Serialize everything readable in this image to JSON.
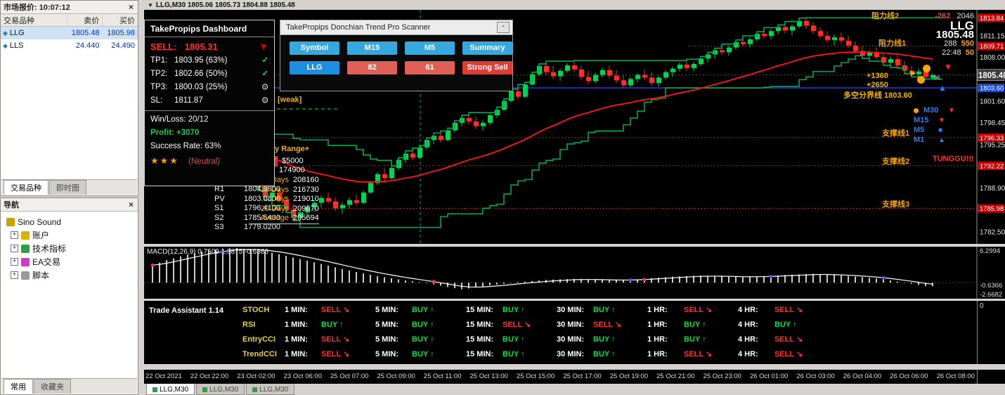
{
  "market_watch": {
    "title": "市场报价: 10:07:12",
    "close": "×",
    "columns": [
      "交易品种",
      "卖价",
      "买价"
    ],
    "rows": [
      {
        "symbol": "LLG",
        "bid": "1805.48",
        "ask": "1805.98"
      },
      {
        "symbol": "LLS",
        "bid": "24.440",
        "ask": "24.490"
      }
    ],
    "tabs": [
      "交易品种",
      "即时图"
    ]
  },
  "navigator": {
    "title": "导航",
    "close": "×",
    "items": [
      {
        "label": "Sino Sound",
        "icon": "speaker-icon",
        "expandable": false
      },
      {
        "label": "账户",
        "icon": "accounts-icon",
        "expandable": true
      },
      {
        "label": "技术指标",
        "icon": "indicators-icon",
        "expandable": true
      },
      {
        "label": "EA交易",
        "icon": "ea-icon",
        "expandable": true
      },
      {
        "label": "脚本",
        "icon": "scripts-icon",
        "expandable": true
      }
    ],
    "tabs": [
      "常用",
      "收藏夹"
    ]
  },
  "chart_titlebar": {
    "dropdown": "▼",
    "title": "LLG,M30 1805.06 1805.73 1804.88 1805.48"
  },
  "dashboard": {
    "title": "TakePropips Dashboard",
    "signal": {
      "label": "SELL:",
      "price": "1805.31",
      "arrow": "▼"
    },
    "targets": [
      {
        "label": "TP1:",
        "value": "1803.95 (63%)",
        "status": "check"
      },
      {
        "label": "TP2:",
        "value": "1802.66 (50%)",
        "status": "check"
      },
      {
        "label": "TP3:",
        "value": "1800.03 (25%)",
        "status": "pending"
      },
      {
        "label": "SL:",
        "value": "1811.87",
        "status": "pending"
      }
    ],
    "stats": [
      {
        "label": "Win/Loss:",
        "value": "20/12",
        "color": "#f2f2f2"
      },
      {
        "label": "Profit:",
        "value": "+3070",
        "color": "#17c94f"
      },
      {
        "label": "Success Rate:",
        "value": "63%",
        "color": "#f2f2f2"
      }
    ],
    "stars": "★★★",
    "rating": "(Neutral)"
  },
  "scanner": {
    "title": "TakePropips Donchian Trend Pro Scanner",
    "minimize": "-",
    "headers": [
      "Symbol",
      "M15",
      "M5",
      "Summary"
    ],
    "row": [
      "LLG",
      "82",
      "61",
      "Strong Sell"
    ]
  },
  "chart": {
    "stats": {
      "r1a": "-262",
      "r1b": "2046",
      "symbol": "LLG",
      "price": "1805.48",
      "r3a": "288",
      "r3b": "550",
      "r4a": "22:48",
      "r4b": "50"
    },
    "levels": [
      {
        "name": "resistance2",
        "label": "阻力线2",
        "price": 1813.84,
        "box": "1813.84"
      },
      {
        "name": "resistance1",
        "label": "阻力线1",
        "price": 1809.71,
        "box": "1809.71"
      },
      {
        "name": "support1",
        "label": "支撑线1",
        "price": 1796.33,
        "box": "1796.33"
      },
      {
        "name": "support2",
        "label": "支撑线2",
        "price": 1792.22,
        "box": "1792.22"
      },
      {
        "name": "support3",
        "label": "支撑线3",
        "price": 1785.98,
        "box": "1785.98"
      }
    ],
    "midline": {
      "label": "多空分界线 1803.60",
      "price": 1803.6,
      "box": "1803.60"
    },
    "plus1": "+1360",
    "plus2": "+2650",
    "weak": "[weak]",
    "tunggu": "TUNGGU!!!",
    "tf_signals": [
      {
        "tf": "M30",
        "dir": "down"
      },
      {
        "tf": "M15",
        "dir": "down"
      },
      {
        "tf": "M5",
        "dir": "flat"
      },
      {
        "tf": "M1",
        "dir": "up"
      }
    ],
    "scale_plain": [
      "1811.15",
      "1808.00",
      "1801.60",
      "1798.45",
      "1795.25",
      "1788.90",
      "1782.50"
    ],
    "current_price": "1805.48",
    "view": {
      "top": 1814.8,
      "bottom": 1781.0
    },
    "candles": [
      [
        1796.0,
        1796.8,
        1795.2,
        1795.6
      ],
      [
        1795.6,
        1796.2,
        1794.5,
        1794.8
      ],
      [
        1794.8,
        1795.5,
        1793.8,
        1794.2
      ],
      [
        1794.2,
        1795.0,
        1793.5,
        1794.6
      ],
      [
        1794.6,
        1795.8,
        1794.3,
        1795.5
      ],
      [
        1795.5,
        1796.0,
        1793.9,
        1794.3
      ],
      [
        1794.3,
        1794.9,
        1792.8,
        1793.1
      ],
      [
        1793.1,
        1794.0,
        1792.2,
        1793.6
      ],
      [
        1793.6,
        1794.8,
        1793.2,
        1794.5
      ],
      [
        1794.5,
        1795.2,
        1793.6,
        1794.0
      ],
      [
        1794.0,
        1794.6,
        1792.5,
        1792.9
      ],
      [
        1792.9,
        1793.8,
        1791.8,
        1792.3
      ],
      [
        1792.3,
        1793.2,
        1791.2,
        1791.6
      ],
      [
        1791.6,
        1792.8,
        1791.0,
        1792.4
      ],
      [
        1792.4,
        1793.0,
        1790.5,
        1790.9
      ],
      [
        1790.9,
        1791.4,
        1788.6,
        1789.0
      ],
      [
        1789.0,
        1789.6,
        1787.2,
        1787.6
      ],
      [
        1787.6,
        1788.8,
        1786.4,
        1788.3
      ],
      [
        1788.3,
        1788.9,
        1786.8,
        1787.2
      ],
      [
        1787.2,
        1787.8,
        1785.4,
        1785.8
      ],
      [
        1785.8,
        1786.6,
        1784.2,
        1784.6
      ],
      [
        1784.6,
        1785.8,
        1783.2,
        1785.4
      ],
      [
        1785.4,
        1786.6,
        1784.8,
        1786.2
      ],
      [
        1786.2,
        1787.2,
        1785.5,
        1786.8
      ],
      [
        1786.8,
        1787.9,
        1786.1,
        1787.5
      ],
      [
        1787.5,
        1788.3,
        1786.6,
        1787.0
      ],
      [
        1787.0,
        1787.6,
        1785.6,
        1786.0
      ],
      [
        1786.0,
        1786.9,
        1785.2,
        1786.5
      ],
      [
        1786.5,
        1787.6,
        1786.0,
        1787.2
      ],
      [
        1787.2,
        1788.0,
        1786.4,
        1786.8
      ],
      [
        1786.8,
        1788.6,
        1786.6,
        1788.3
      ],
      [
        1788.3,
        1790.0,
        1788.1,
        1789.7
      ],
      [
        1789.7,
        1791.3,
        1789.4,
        1791.0
      ],
      [
        1791.0,
        1791.9,
        1790.0,
        1790.4
      ],
      [
        1790.4,
        1792.2,
        1790.2,
        1791.9
      ],
      [
        1791.9,
        1793.4,
        1791.6,
        1793.1
      ],
      [
        1793.1,
        1794.4,
        1792.6,
        1794.0
      ],
      [
        1794.0,
        1794.8,
        1793.0,
        1793.4
      ],
      [
        1793.4,
        1795.2,
        1793.2,
        1794.9
      ],
      [
        1794.9,
        1796.3,
        1794.6,
        1796.0
      ],
      [
        1796.0,
        1797.0,
        1795.4,
        1796.6
      ],
      [
        1796.6,
        1797.3,
        1795.6,
        1796.0
      ],
      [
        1796.0,
        1797.7,
        1795.8,
        1797.4
      ],
      [
        1797.4,
        1798.8,
        1797.1,
        1798.5
      ],
      [
        1798.5,
        1799.6,
        1798.0,
        1799.2
      ],
      [
        1799.2,
        1800.0,
        1798.3,
        1798.7
      ],
      [
        1798.7,
        1799.4,
        1797.6,
        1798.0
      ],
      [
        1798.0,
        1798.9,
        1797.3,
        1798.5
      ],
      [
        1798.5,
        1799.9,
        1798.2,
        1799.6
      ],
      [
        1799.6,
        1800.8,
        1799.2,
        1800.4
      ],
      [
        1800.4,
        1802.0,
        1800.2,
        1801.7
      ],
      [
        1801.7,
        1803.4,
        1801.5,
        1803.1
      ],
      [
        1803.1,
        1804.1,
        1801.9,
        1802.3
      ],
      [
        1802.3,
        1804.4,
        1802.1,
        1804.1
      ],
      [
        1804.1,
        1805.9,
        1803.9,
        1805.6
      ],
      [
        1805.6,
        1807.1,
        1805.3,
        1806.8
      ],
      [
        1806.8,
        1807.5,
        1805.5,
        1805.9
      ],
      [
        1805.9,
        1806.8,
        1804.9,
        1805.3
      ],
      [
        1805.3,
        1806.4,
        1804.6,
        1806.1
      ],
      [
        1806.1,
        1807.2,
        1805.8,
        1806.9
      ],
      [
        1806.9,
        1807.6,
        1805.9,
        1806.3
      ],
      [
        1806.3,
        1806.9,
        1804.8,
        1805.2
      ],
      [
        1805.2,
        1806.1,
        1804.2,
        1804.6
      ],
      [
        1804.6,
        1805.8,
        1804.3,
        1805.5
      ],
      [
        1805.5,
        1806.6,
        1805.1,
        1806.2
      ],
      [
        1806.2,
        1806.9,
        1805.0,
        1805.4
      ],
      [
        1805.4,
        1806.2,
        1804.3,
        1804.7
      ],
      [
        1804.7,
        1805.5,
        1803.6,
        1804.0
      ],
      [
        1804.0,
        1805.2,
        1803.7,
        1804.9
      ],
      [
        1804.9,
        1805.8,
        1804.4,
        1805.5
      ],
      [
        1805.5,
        1806.3,
        1804.7,
        1805.1
      ],
      [
        1805.1,
        1805.9,
        1803.9,
        1804.3
      ],
      [
        1804.3,
        1805.4,
        1803.8,
        1805.1
      ],
      [
        1805.1,
        1806.2,
        1804.8,
        1805.9
      ],
      [
        1805.9,
        1806.7,
        1805.2,
        1806.4
      ],
      [
        1806.4,
        1807.3,
        1806.0,
        1807.0
      ],
      [
        1807.0,
        1807.8,
        1806.1,
        1806.5
      ],
      [
        1806.5,
        1807.4,
        1806.0,
        1807.1
      ],
      [
        1807.1,
        1808.2,
        1806.8,
        1807.9
      ],
      [
        1807.9,
        1808.8,
        1807.3,
        1808.5
      ],
      [
        1808.5,
        1809.4,
        1807.8,
        1809.1
      ],
      [
        1809.1,
        1810.0,
        1808.4,
        1808.8
      ],
      [
        1808.8,
        1809.8,
        1808.3,
        1809.5
      ],
      [
        1809.5,
        1810.6,
        1809.2,
        1810.3
      ],
      [
        1810.3,
        1811.2,
        1809.6,
        1810.0
      ],
      [
        1810.0,
        1811.0,
        1809.5,
        1810.7
      ],
      [
        1810.7,
        1811.8,
        1810.4,
        1811.5
      ],
      [
        1811.5,
        1812.4,
        1810.8,
        1811.2
      ],
      [
        1811.2,
        1812.2,
        1810.7,
        1811.9
      ],
      [
        1811.9,
        1812.8,
        1811.4,
        1812.5
      ],
      [
        1812.5,
        1813.3,
        1811.6,
        1812.0
      ],
      [
        1812.0,
        1812.9,
        1811.3,
        1812.6
      ],
      [
        1812.6,
        1813.8,
        1812.3,
        1813.4
      ],
      [
        1813.4,
        1813.84,
        1812.2,
        1812.7
      ],
      [
        1812.7,
        1813.2,
        1811.5,
        1811.9
      ],
      [
        1811.9,
        1812.5,
        1810.8,
        1811.2
      ],
      [
        1811.2,
        1811.9,
        1810.2,
        1810.6
      ],
      [
        1810.6,
        1811.4,
        1809.8,
        1811.0
      ],
      [
        1811.0,
        1811.7,
        1810.1,
        1810.5
      ],
      [
        1810.5,
        1811.2,
        1809.4,
        1809.8
      ],
      [
        1809.8,
        1810.4,
        1808.6,
        1809.0
      ],
      [
        1809.0,
        1809.7,
        1807.9,
        1808.3
      ],
      [
        1808.3,
        1809.1,
        1807.5,
        1808.8
      ],
      [
        1808.8,
        1809.5,
        1807.8,
        1808.1
      ],
      [
        1808.1,
        1808.7,
        1806.9,
        1807.3
      ],
      [
        1807.3,
        1808.2,
        1806.6,
        1807.8
      ],
      [
        1807.8,
        1808.4,
        1806.5,
        1806.9
      ],
      [
        1806.9,
        1807.5,
        1805.7,
        1806.1
      ],
      [
        1806.1,
        1806.8,
        1805.2,
        1805.6
      ],
      [
        1805.6,
        1806.4,
        1804.9,
        1806.0
      ],
      [
        1806.0,
        1806.5,
        1804.9,
        1805.2
      ],
      [
        1805.06,
        1805.73,
        1804.88,
        1805.48
      ]
    ]
  },
  "pivots": {
    "rows": [
      [
        "R1",
        "1804.9800"
      ],
      [
        "PV",
        "1803.0800"
      ],
      [
        "S1",
        "1796.4100"
      ],
      [
        "S2",
        "1785.5400"
      ],
      [
        "S3",
        "1779.0200"
      ]
    ]
  },
  "daily_range": {
    "title": "y Range+",
    "today": "y",
    "today_value": "$5000",
    "current": "174900",
    "rows": [
      [
        "Days",
        "208160"
      ],
      [
        "10 Days",
        "216730"
      ],
      [
        "Days",
        "219010"
      ],
      [
        "20 Days",
        "209670"
      ],
      [
        "Average",
        "205694"
      ]
    ]
  },
  "macd": {
    "label": "MACD(12,26,9) 0.7509 1.3875 -0.6366",
    "scale": [
      "6.2994",
      "-0.6366",
      "-2.6682"
    ],
    "hist": [
      3.2,
      4.1,
      4.8,
      5.4,
      5.9,
      6.2,
      6.3,
      6.1,
      5.7,
      5.2,
      4.6,
      4.0,
      3.4,
      2.8,
      2.2,
      1.7,
      1.2,
      0.8,
      0.4,
      0.1,
      -0.3,
      -0.8,
      -1.2,
      -0.9,
      -0.5,
      -0.2,
      0.1,
      0.3,
      0.5,
      0.6,
      0.7,
      0.6,
      0.5,
      0.4,
      0.5,
      0.7,
      0.9,
      1.1,
      1.2,
      1.3,
      1.2,
      1.1,
      1.0,
      1.1,
      1.2,
      1.4,
      1.5,
      1.6,
      1.5,
      1.3,
      1.1,
      0.9,
      0.6,
      0.2,
      -0.2,
      -0.64
    ],
    "dots": [
      {
        "i": 0,
        "c": "#ff3535"
      },
      {
        "i": 10,
        "c": "#4455ff"
      },
      {
        "i": 40,
        "c": "#ff3535"
      },
      {
        "i": 68,
        "c": "#4455ff"
      },
      {
        "i": 70,
        "c": "#ff3535"
      },
      {
        "i": 88,
        "c": "#4455ff"
      },
      {
        "i": 104,
        "c": "#4455ff"
      }
    ]
  },
  "trade_assistant": {
    "title": "Trade Assistant 1.14",
    "scale_zero": "0",
    "timeframes": [
      "1 MIN:",
      "5 MIN:",
      "15 MIN:",
      "30 MIN:",
      "1 HR:",
      "4 HR:"
    ],
    "rows": [
      {
        "name": "STOCH",
        "signals": [
          "SELL",
          "BUY",
          "BUY",
          "BUY",
          "SELL",
          "SELL"
        ]
      },
      {
        "name": "RSI",
        "signals": [
          "BUY",
          "BUY",
          "SELL",
          "SELL",
          "BUY",
          "BUY"
        ]
      },
      {
        "name": "EntryCCI",
        "signals": [
          "SELL",
          "BUY",
          "BUY",
          "BUY",
          "BUY",
          "SELL"
        ]
      },
      {
        "name": "TrendCCI",
        "signals": [
          "SELL",
          "BUY",
          "BUY",
          "BUY",
          "SELL",
          "SELL"
        ]
      }
    ]
  },
  "time_axis": [
    "22 Oct 2021",
    "22 Oct 22:00",
    "23 Oct 02:00",
    "23 Oct 06:00",
    "25 Oct 07:00",
    "25 Oct 09:00",
    "25 Oct 11:00",
    "25 Oct 13:00",
    "25 Oct 15:00",
    "25 Oct 17:00",
    "25 Oct 19:00",
    "25 Oct 21:00",
    "25 Oct 23:00",
    "26 Oct 01:00",
    "26 Oct 03:00",
    "26 Oct 04:00",
    "26 Oct 06:00",
    "26 Oct 08:00"
  ],
  "chart_tabs": [
    "LLG,M30",
    "LLG,M30",
    "LLG,M30"
  ]
}
